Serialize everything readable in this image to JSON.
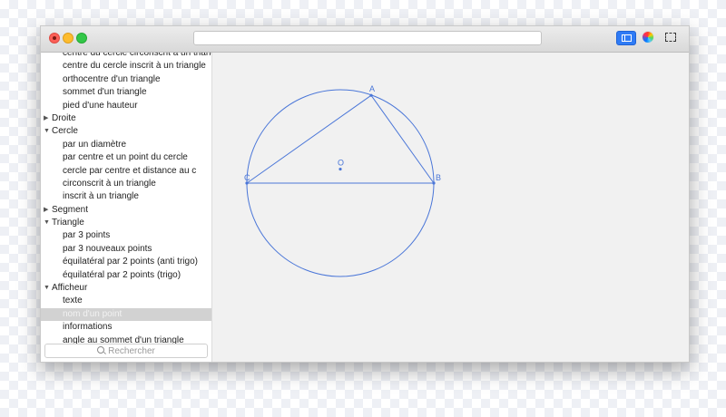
{
  "window": {
    "url_value": ""
  },
  "sidebar": {
    "rows": [
      {
        "label": "centre du cercle circonscrit à un triangle",
        "kind": "child",
        "selected": false
      },
      {
        "label": "centre du cercle inscrit à un triangle",
        "kind": "child",
        "selected": false
      },
      {
        "label": "orthocentre d'un triangle",
        "kind": "child",
        "selected": false
      },
      {
        "label": "sommet d'un triangle",
        "kind": "child",
        "selected": false
      },
      {
        "label": "pied d'une hauteur",
        "kind": "child",
        "selected": false
      },
      {
        "label": "Droite",
        "kind": "group",
        "expanded": false
      },
      {
        "label": "Cercle",
        "kind": "group",
        "expanded": true
      },
      {
        "label": "par un diamètre",
        "kind": "child",
        "selected": false
      },
      {
        "label": "par centre et un point du cercle",
        "kind": "child",
        "selected": false
      },
      {
        "label": "cercle par centre et distance au c",
        "kind": "child",
        "selected": false
      },
      {
        "label": "circonscrit à un triangle",
        "kind": "child",
        "selected": false
      },
      {
        "label": "inscrit à un triangle",
        "kind": "child",
        "selected": false
      },
      {
        "label": "Segment",
        "kind": "group",
        "expanded": false
      },
      {
        "label": "Triangle",
        "kind": "group",
        "expanded": true
      },
      {
        "label": "par 3 points",
        "kind": "child",
        "selected": false
      },
      {
        "label": "par 3 nouveaux points",
        "kind": "child",
        "selected": false
      },
      {
        "label": "équilatéral par 2 points (anti trigo)",
        "kind": "child",
        "selected": false
      },
      {
        "label": "équilatéral par 2 points (trigo)",
        "kind": "child",
        "selected": false
      },
      {
        "label": "Afficheur",
        "kind": "group",
        "expanded": true
      },
      {
        "label": "texte",
        "kind": "child",
        "selected": false
      },
      {
        "label": "nom d'un point",
        "kind": "child",
        "selected": true
      },
      {
        "label": "informations",
        "kind": "child",
        "selected": false
      },
      {
        "label": "angle au sommet d'un triangle",
        "kind": "child",
        "selected": false
      }
    ],
    "search_placeholder": "Rechercher"
  },
  "figure": {
    "stroke_color": "#4a76d8",
    "points": [
      {
        "name": "A",
        "x": 0.33,
        "y": 0.94
      },
      {
        "name": "B",
        "x": 1.0,
        "y": 0.0
      },
      {
        "name": "C",
        "x": -1.0,
        "y": 0.0
      },
      {
        "name": "O",
        "x": 0.0,
        "y": 0.15
      }
    ],
    "circle": {
      "center": "O",
      "radius": 1.0
    },
    "triangle": [
      "A",
      "B",
      "C"
    ]
  },
  "icons": {
    "sidebar_toggle": "sidebar-icon",
    "color_picker": "color-wheel-icon",
    "selection": "selection-icon",
    "search": "search-icon"
  }
}
